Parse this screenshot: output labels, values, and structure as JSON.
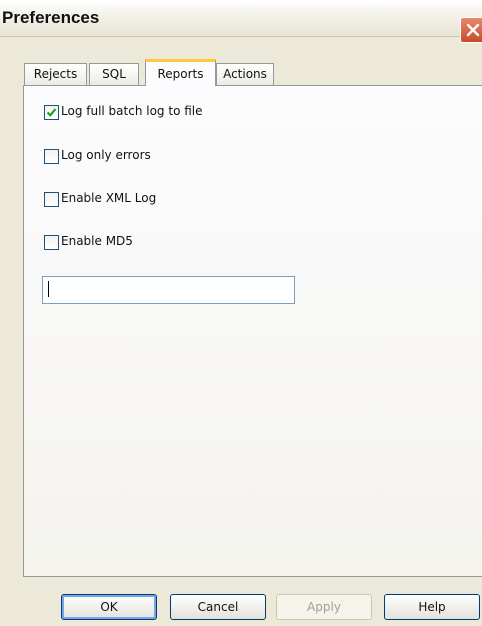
{
  "window": {
    "title": "Preferences"
  },
  "tabs": [
    {
      "label": "Rejects",
      "active": false
    },
    {
      "label": "SQL",
      "active": false
    },
    {
      "label": "Reports",
      "active": true
    },
    {
      "label": "Actions",
      "active": false
    }
  ],
  "reports": {
    "options": [
      {
        "label": "Log full batch log to file",
        "checked": true
      },
      {
        "label": "Log only errors",
        "checked": false
      },
      {
        "label": "Enable XML Log",
        "checked": false
      },
      {
        "label": "Enable MD5",
        "checked": false
      }
    ],
    "text_field": {
      "value": ""
    }
  },
  "buttons": {
    "ok": "OK",
    "cancel": "Cancel",
    "apply": "Apply",
    "help": "Help"
  },
  "colors": {
    "accent_tab": "#ffc83c",
    "close_button": "#c94a2b",
    "checkmark": "#21a121"
  }
}
